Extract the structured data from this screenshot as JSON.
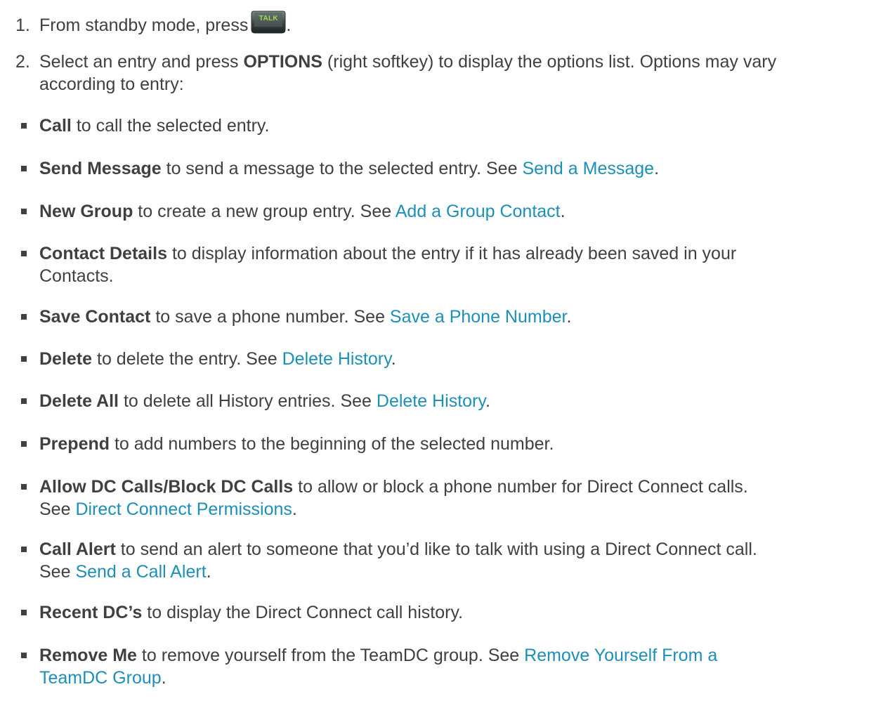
{
  "step1": {
    "number": "1.",
    "text": "From standby mode, press",
    "key_label": "TALK",
    "trailing": "."
  },
  "step2": {
    "number": "2.",
    "pre": "Select an entry and press",
    "bold": "OPTIONS",
    "post": "(right softkey) to display the options list. Options may vary",
    "line2": "according to entry:"
  },
  "options": [
    {
      "bold": "Call",
      "text": "to call the selected entry."
    },
    {
      "bold": "Send Message",
      "text": "to send a message to the selected entry. See",
      "link": "Send a Message",
      "end": "."
    },
    {
      "bold": "New Group",
      "text": "to create a new group entry. See",
      "link": "Add a Group Contact",
      "end": "."
    },
    {
      "bold": "Contact Details",
      "text": "to display information about the entry if it has already been saved in your",
      "line2": "Contacts."
    },
    {
      "bold": "Save Contact",
      "text": "to save a phone number. See",
      "link": "Save a Phone Number",
      "end": "."
    },
    {
      "bold": "Delete",
      "text": "to delete the entry. See",
      "link": "Delete History",
      "end": "."
    },
    {
      "bold": "Delete All",
      "text": "to delete all History entries. See",
      "link": "Delete History",
      "end": "."
    },
    {
      "bold": "Prepend",
      "text": "to add numbers to the beginning of the selected number."
    },
    {
      "bold": "Allow DC Calls/Block DC Calls",
      "text": "to allow or block a phone number for Direct Connect calls.",
      "line2_pre": "See",
      "link": "Direct Connect Permissions",
      "end": "."
    },
    {
      "bold": "Call Alert",
      "text": "to send an alert to someone that you’d like to talk with using a Direct Connect call.",
      "line2_pre": "See",
      "link": "Send a Call Alert",
      "end": "."
    },
    {
      "bold": "Recent DC’s",
      "text": "to display the Direct Connect call history."
    },
    {
      "bold": "Remove Me",
      "text": "to remove yourself from the TeamDC group. See",
      "link": "Remove Yourself From a",
      "link2": "TeamDC Group",
      "end": "."
    }
  ]
}
